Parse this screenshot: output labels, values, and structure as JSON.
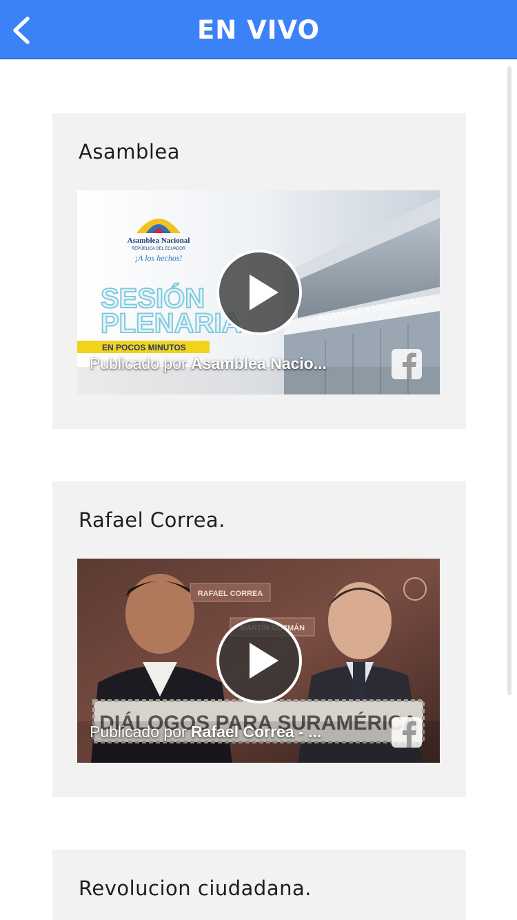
{
  "header": {
    "title": "EN VIVO",
    "back_icon": "chevron-left-icon",
    "background_color": "#3b82f6"
  },
  "cards": [
    {
      "title": "Asamblea",
      "video": {
        "caption_prefix": "Publicado por",
        "caption_author": "Asamblea Nacio...",
        "thumbnail_texts": {
          "org_name": "Asamblea Nacional",
          "org_sub": "REPÚBLICA DEL ECUADOR",
          "slogan": "¡A los hechos!",
          "line1": "SESIÓN",
          "line2": "PLENARIA",
          "ribbon": "EN POCOS MINUTOS",
          "building": "ASAMBLEA NACIONAL"
        }
      }
    },
    {
      "title": "Rafael Correa.",
      "video": {
        "caption_prefix": "Publicado por",
        "caption_author": "Rafael Correa - ...",
        "thumbnail_texts": {
          "tag1": "RAFAEL CORREA",
          "tag2": "MARTÍN GUZMÁN",
          "banner": "DIÁLOGOS PARA SURAMÉRICA"
        }
      }
    },
    {
      "title": "Revolucion ciudadana."
    }
  ],
  "icons": {
    "play": "play-icon",
    "facebook": "facebook-icon"
  }
}
